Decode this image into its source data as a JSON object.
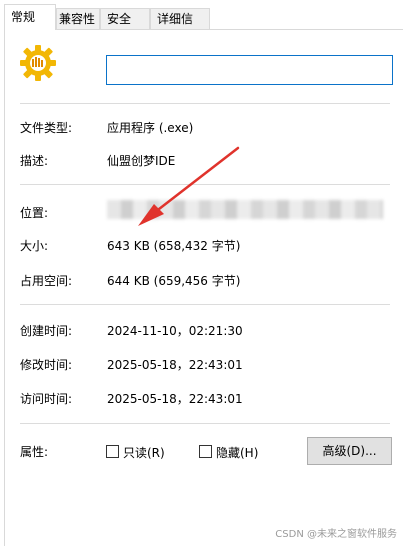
{
  "tabs": [
    {
      "label": "常规"
    },
    {
      "label": "兼容性"
    },
    {
      "label": "安全"
    },
    {
      "label": "详细信息"
    }
  ],
  "general": {
    "file_name": "",
    "file_type_label": "文件类型:",
    "file_type_value": "应用程序 (.exe)",
    "description_label": "描述:",
    "description_value": "仙盟创梦IDE",
    "location_label": "位置:",
    "size_label": "大小:",
    "size_value": "643 KB (658,432 字节)",
    "size_on_disk_label": "占用空间:",
    "size_on_disk_value": "644 KB (659,456 字节)",
    "created_label": "创建时间:",
    "created_value": "2024-11-10，02:21:30",
    "modified_label": "修改时间:",
    "modified_value": "2025-05-18，22:43:01",
    "accessed_label": "访问时间:",
    "accessed_value": "2025-05-18，22:43:01",
    "attributes_label": "属性:",
    "readonly_label": "只读(R)",
    "hidden_label": "隐藏(H)",
    "advanced_button": "高级(D)..."
  },
  "watermark": "CSDN @未来之窗软件服务",
  "colors": {
    "arrow": "#e0332c",
    "icon_gold": "#f2b705",
    "focus_border": "#0b73c9"
  }
}
